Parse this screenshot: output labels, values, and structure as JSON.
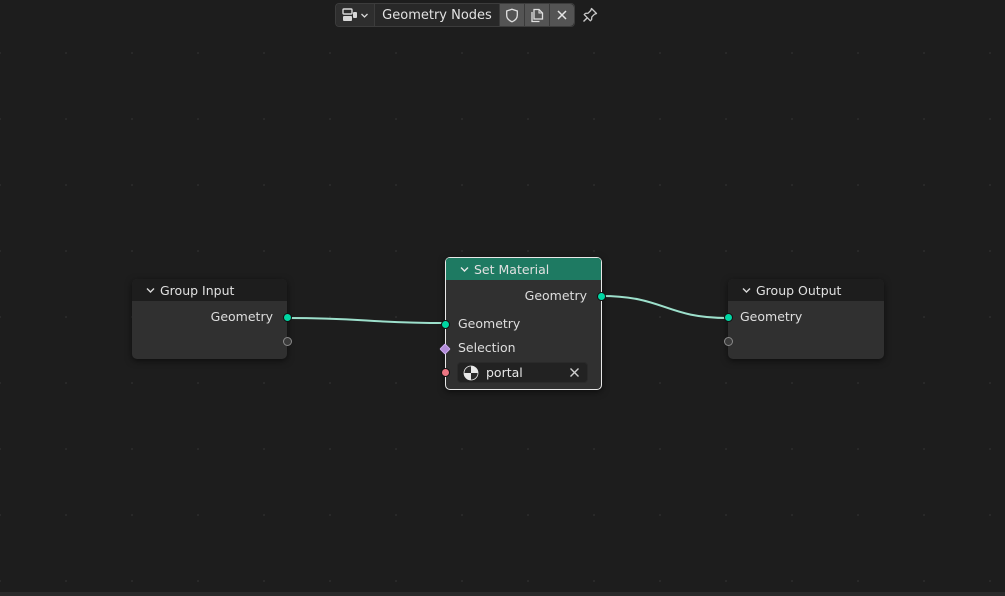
{
  "header": {
    "tree_name": "Geometry Nodes",
    "tree_type_icon": "node-tree-icon",
    "fake_user_icon": "shield-icon",
    "duplicate_icon": "duplicate-icon",
    "unlink_icon": "close-icon",
    "pin_icon": "pin-icon"
  },
  "nodes": {
    "group_input": {
      "title": "Group Input",
      "outputs": [
        {
          "label": "Geometry",
          "type": "geometry"
        },
        {
          "label": "",
          "type": "empty"
        }
      ]
    },
    "set_material": {
      "title": "Set Material",
      "outputs": [
        {
          "label": "Geometry",
          "type": "geometry"
        }
      ],
      "inputs": [
        {
          "label": "Geometry",
          "type": "geometry"
        },
        {
          "label": "Selection",
          "type": "boolean"
        },
        {
          "label": "Material",
          "type": "material",
          "value": "portal"
        }
      ],
      "material_value": "portal"
    },
    "group_output": {
      "title": "Group Output",
      "inputs": [
        {
          "label": "Geometry",
          "type": "geometry"
        },
        {
          "label": "",
          "type": "empty"
        }
      ]
    }
  },
  "links": [
    {
      "from": "group_input.Geometry",
      "to": "set_material.Geometry"
    },
    {
      "from": "set_material.Geometry",
      "to": "group_output.Geometry"
    }
  ],
  "colors": {
    "background": "#1d1d1d",
    "node_body": "#303030",
    "node_header": "#1d1d1d",
    "geometry_node_header": "#1e7a62",
    "geometry_socket": "#00d6a3",
    "boolean_socket": "#b28bd8",
    "material_socket": "#eb7582",
    "link": "#9de0cc"
  }
}
